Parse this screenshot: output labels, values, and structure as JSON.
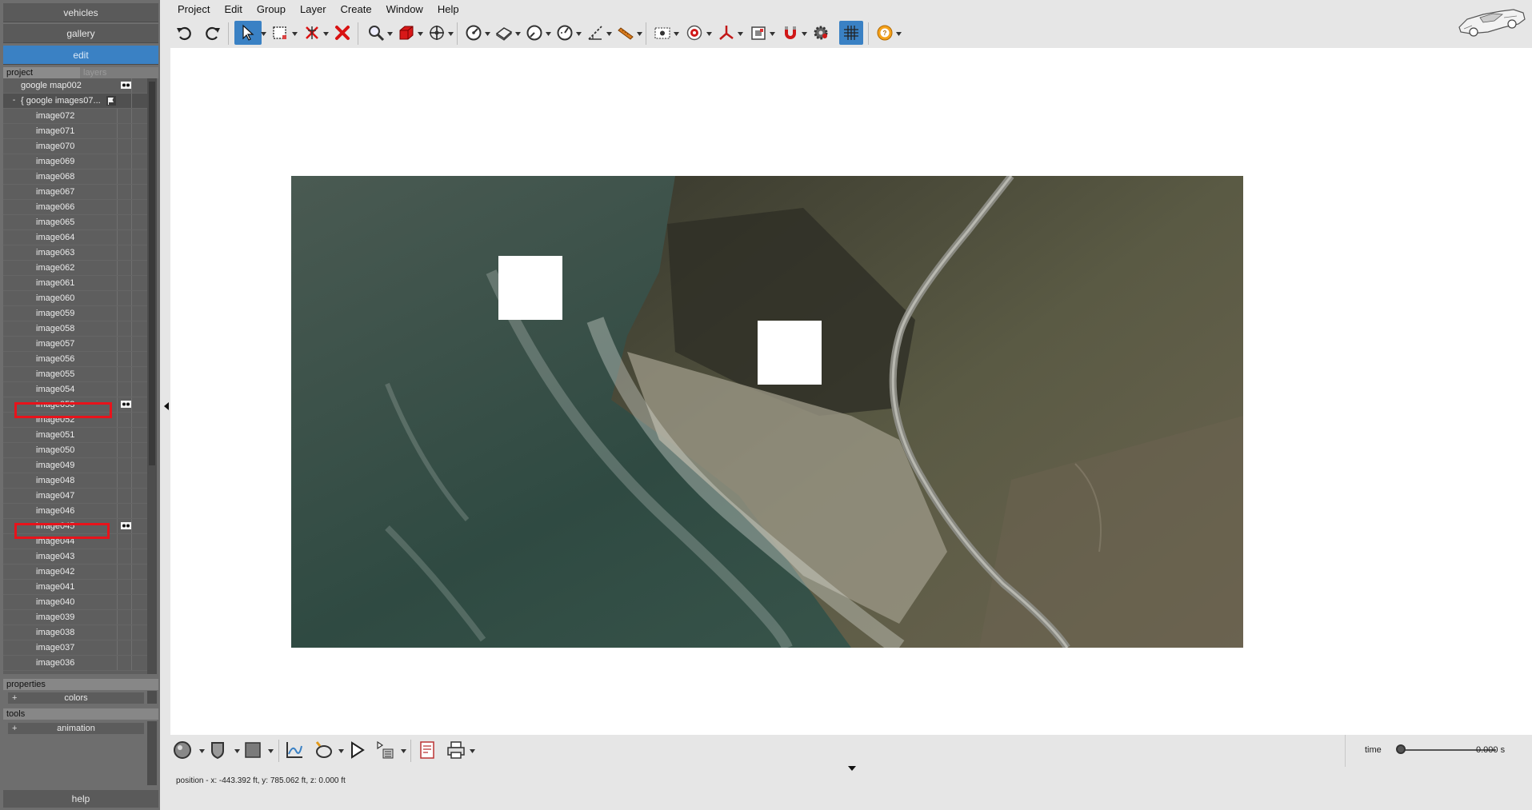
{
  "left_panel": {
    "modes": [
      "vehicles",
      "gallery",
      "edit"
    ],
    "active_mode": "edit",
    "tabs": {
      "project": "project",
      "layers": "layers"
    },
    "tree": {
      "root_item": "google map002",
      "group_item": "{ google images07...",
      "group_expander": "-",
      "images": [
        "image072",
        "image071",
        "image070",
        "image069",
        "image068",
        "image067",
        "image066",
        "image065",
        "image064",
        "image063",
        "image062",
        "image061",
        "image060",
        "image059",
        "image058",
        "image057",
        "image056",
        "image055",
        "image054",
        "image053",
        "image052",
        "image051",
        "image050",
        "image049",
        "image048",
        "image047",
        "image046",
        "image045",
        "image044",
        "image043",
        "image042",
        "image041",
        "image040",
        "image039",
        "image038",
        "image037",
        "image036"
      ],
      "highlighted_images": [
        "image053",
        "image045"
      ]
    },
    "properties": {
      "label": "properties",
      "colors": "colors"
    },
    "tools": {
      "label": "tools",
      "animation": "animation"
    },
    "plus_symbol": "+",
    "help": "help"
  },
  "menu": [
    "Project",
    "Edit",
    "Group",
    "Layer",
    "Create",
    "Window",
    "Help"
  ],
  "toolbar_icons": [
    "undo-icon",
    "redo-icon",
    "select-arrow-icon",
    "box-select-icon",
    "delete-component-icon",
    "close-x-icon",
    "zoom-icon",
    "solid-box-icon",
    "move-icon",
    "measure-angle-icon",
    "measure-area-icon",
    "gauge-icon",
    "timer-gauge-icon",
    "measure-length-icon",
    "ruler-icon",
    "screen-capture-icon",
    "target-icon",
    "axis-icon",
    "image-frame-icon",
    "magnet-icon",
    "settings-gears-icon",
    "grid-icon",
    "help-icon"
  ],
  "time": {
    "label": "time",
    "value": "0.000 s",
    "slider_fraction": 0.0
  },
  "status": {
    "position": "position - x: -443.392 ft, y: 785.062 ft, z: 0.000 ft"
  },
  "colors": {
    "accent": "#3a81c4",
    "highlight": "#e8131b",
    "panel": "#6e6e6e"
  }
}
